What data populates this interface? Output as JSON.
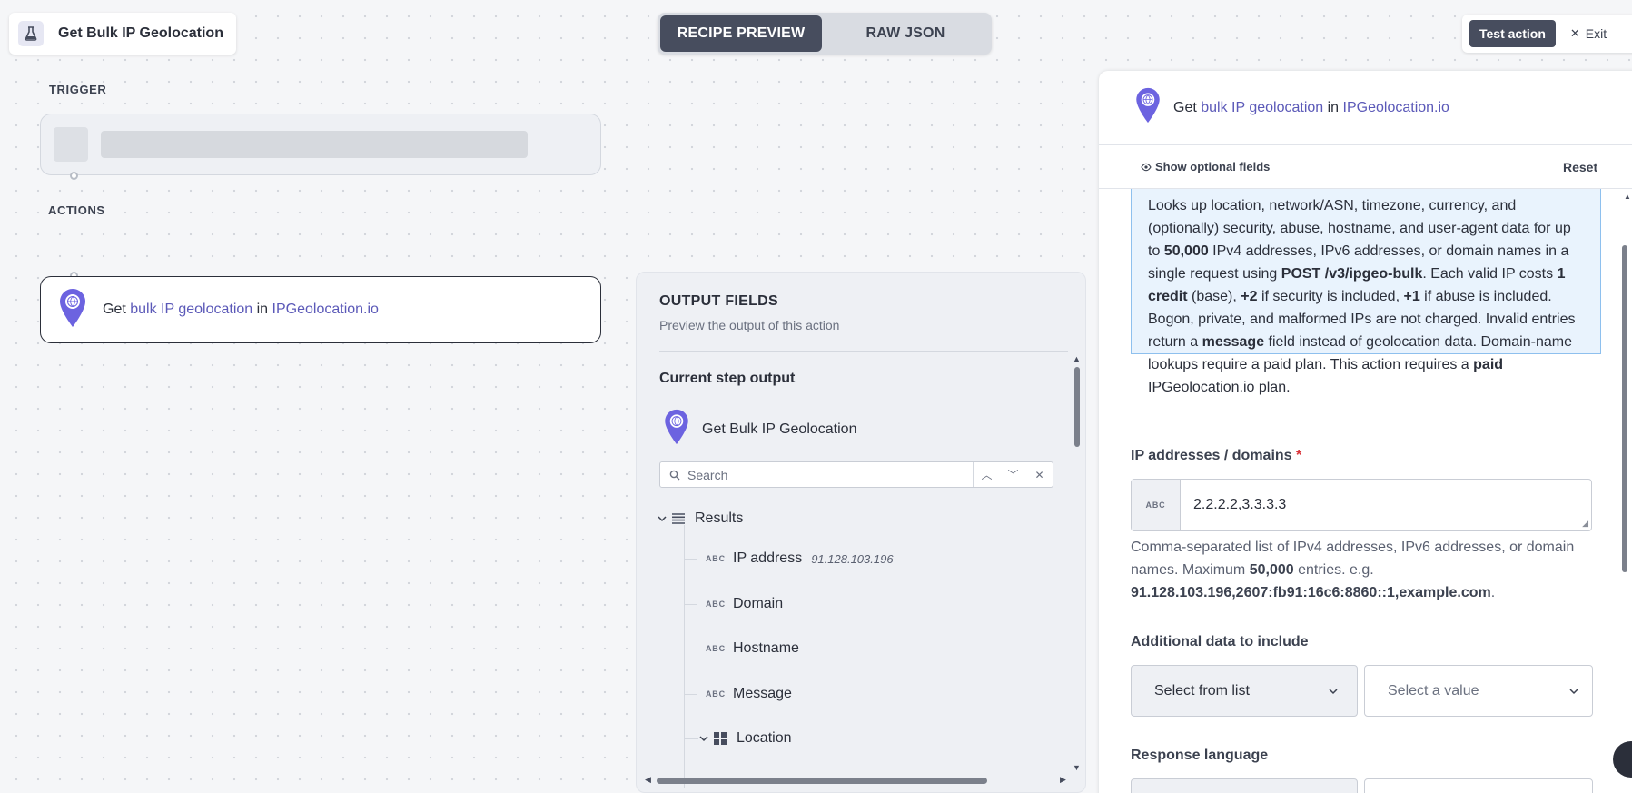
{
  "recipe": {
    "title": "Get Bulk IP Geolocation"
  },
  "view_toggle": {
    "preview": "RECIPE PREVIEW",
    "raw": "RAW JSON"
  },
  "topbar": {
    "test_action": "Test action",
    "exit": "Exit"
  },
  "flow": {
    "trigger_label": "TRIGGER",
    "actions_label": "ACTIONS",
    "action": {
      "prefix": "Get",
      "verb": "bulk IP geolocation",
      "mid": "in",
      "app": "IPGeolocation.io"
    }
  },
  "output": {
    "title": "OUTPUT FIELDS",
    "subtitle": "Preview the output of this action",
    "current_step": "Current step output",
    "step_name": "Get Bulk IP Geolocation",
    "search_placeholder": "Search",
    "type_abc": "ABC",
    "results": "Results",
    "fields": [
      {
        "name": "IP address",
        "sample": "91.128.103.196"
      },
      {
        "name": "Domain"
      },
      {
        "name": "Hostname"
      },
      {
        "name": "Message"
      }
    ],
    "location": "Location"
  },
  "config": {
    "header": {
      "prefix": "Get",
      "verb": "bulk IP geolocation",
      "mid": "in",
      "app": "IPGeolocation.io"
    },
    "show_optional": "Show optional fields",
    "reset": "Reset",
    "description": {
      "t1": "Looks up location, network/ASN, timezone, currency, and (optionally) security, abuse, hostname, and user-agent data for up to ",
      "b1": "50,000",
      "t2": " IPv4 addresses, IPv6 addresses, or domain names in a single request using ",
      "b2": "POST /v3/ipgeo-bulk",
      "t3": ". Each valid IP costs ",
      "b3": "1 credit",
      "t4": " (base), ",
      "b4": "+2",
      "t5": " if security is included, ",
      "b5": "+1",
      "t6": " if abuse is included. Bogon, private, and malformed IPs are not charged. Invalid entries return a ",
      "b6": "message",
      "t7": " field instead of geolocation data. Domain-name lookups require a paid plan. This action requires a ",
      "b7": "paid",
      "t8": " IPGeolocation.io plan."
    },
    "ip_field": {
      "label": "IP addresses / domains",
      "required": "*",
      "type": "ABC",
      "value": "2.2.2.2,3.3.3.3",
      "hint_t1": "Comma-separated list of IPv4 addresses, IPv6 addresses, or domain names. Maximum ",
      "hint_b1": "50,000",
      "hint_t2": " entries. e.g. ",
      "hint_b2": "91.128.103.196,2607:fb91:16c6:8860::1,example.com",
      "hint_t3": "."
    },
    "additional": {
      "label": "Additional data to include",
      "select_list": "Select from list",
      "select_value": "Select a value"
    },
    "language": {
      "label": "Response language"
    }
  },
  "colors": {
    "accent": "#5b59b8",
    "pin": "#6c63e0",
    "dark": "#474d5e",
    "info_bg": "#e9f3fd",
    "info_border": "#8ec0ee"
  }
}
